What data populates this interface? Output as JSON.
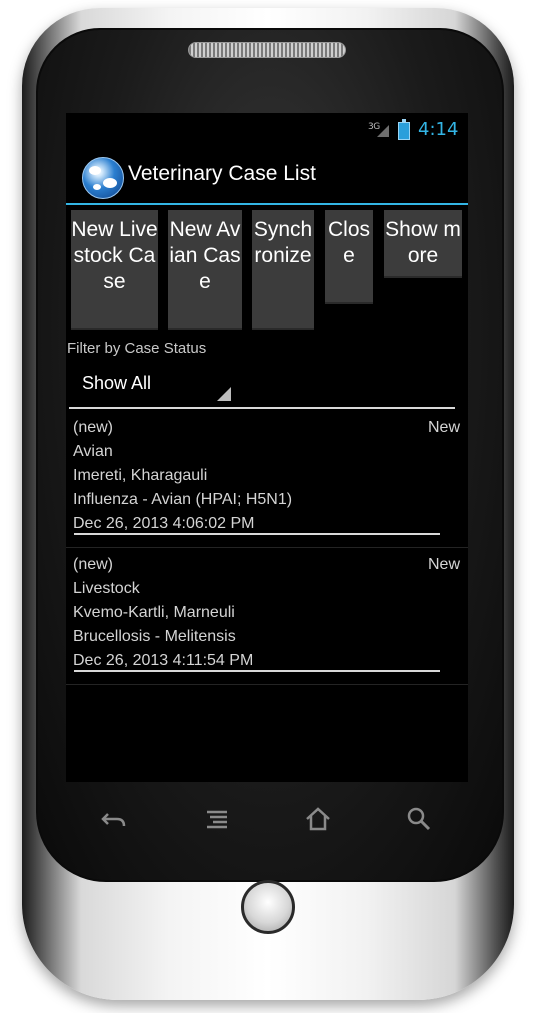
{
  "status_bar": {
    "network": "3G",
    "time": "4:14",
    "accent_color": "#33b5e5"
  },
  "action_bar": {
    "title": "Veterinary Case List",
    "icon": "globe-app-icon"
  },
  "buttons": [
    {
      "label": "New Livestock Case"
    },
    {
      "label": "New Avian Case"
    },
    {
      "label": "Synchronize"
    },
    {
      "label": "Close"
    },
    {
      "label": "Show more"
    }
  ],
  "filter": {
    "label": "Filter by Case Status",
    "selected": "Show All"
  },
  "cases": [
    {
      "name": "(new)",
      "status": "New",
      "type": "Avian",
      "location": "Imereti, Kharagauli",
      "disease": "Influenza - Avian (HPAI; H5N1)",
      "date": "Dec 26, 2013 4:06:02 PM"
    },
    {
      "name": "(new)",
      "status": "New",
      "type": "Livestock",
      "location": "Kvemo-Kartli, Marneuli",
      "disease": "Brucellosis - Melitensis",
      "date": "Dec 26, 2013 4:11:54 PM"
    }
  ],
  "nav": {
    "back": "back-icon",
    "menu": "menu-icon",
    "home": "home-icon",
    "search": "search-icon"
  }
}
